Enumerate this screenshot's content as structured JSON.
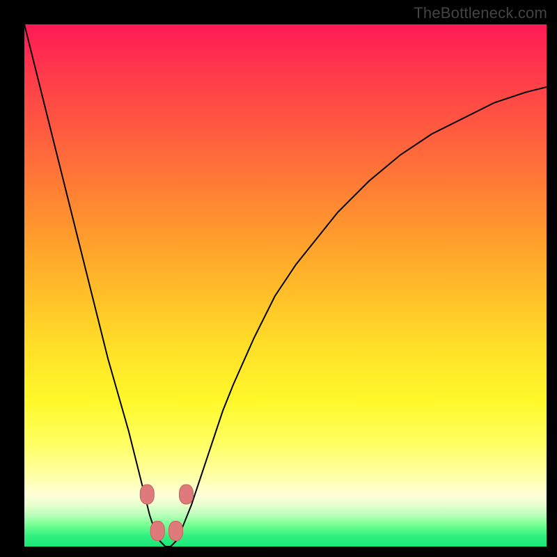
{
  "watermark": "TheBottleneck.com",
  "colors": {
    "frame": "#000000",
    "watermark": "#444444",
    "curve": "#000000",
    "marker_fill": "#df7a7a",
    "marker_stroke": "#c96060"
  },
  "chart_data": {
    "type": "line",
    "title": "",
    "xlabel": "",
    "ylabel": "",
    "xlim": [
      0,
      100
    ],
    "ylim": [
      0,
      100
    ],
    "grid": false,
    "legend": false,
    "series": [
      {
        "name": "bottleneck-curve",
        "x": [
          0,
          2,
          4,
          6,
          8,
          10,
          12,
          14,
          16,
          18,
          20,
          21,
          22,
          23,
          24,
          25,
          26,
          27,
          28,
          29,
          30,
          32,
          34,
          36,
          38,
          40,
          44,
          48,
          52,
          56,
          60,
          66,
          72,
          78,
          84,
          90,
          96,
          100
        ],
        "y": [
          100,
          92,
          84,
          76,
          68,
          60,
          52,
          44,
          36,
          29,
          22,
          18,
          14,
          10,
          6,
          3,
          1,
          0,
          0,
          1,
          3,
          8,
          14,
          20,
          26,
          31,
          40,
          48,
          54,
          59,
          64,
          70,
          75,
          79,
          82,
          85,
          87,
          88
        ]
      }
    ],
    "markers": [
      {
        "name": "left-upper",
        "x": 23.5,
        "y": 10
      },
      {
        "name": "left-lower",
        "x": 25.5,
        "y": 3
      },
      {
        "name": "right-lower",
        "x": 29.0,
        "y": 3
      },
      {
        "name": "right-upper",
        "x": 31.0,
        "y": 10
      }
    ]
  }
}
